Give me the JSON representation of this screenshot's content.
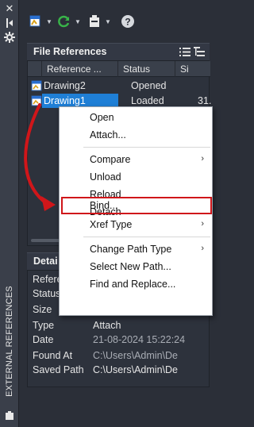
{
  "strip": {
    "vertical_label": "EXTERNAL REFERENCES",
    "icons": [
      "close-icon",
      "autohide-icon",
      "properties-icon"
    ]
  },
  "toolbar": {
    "buttons": [
      "attach-dwg-icon",
      "refresh-icon",
      "change-path-icon",
      "help-icon"
    ]
  },
  "file_references": {
    "title": "File References",
    "columns": [
      "Reference ...",
      "Status",
      "Si"
    ],
    "rows": [
      {
        "name": "Drawing2",
        "status": "Opened",
        "size": ""
      },
      {
        "name": "Drawing1",
        "status": "Loaded",
        "size": "31."
      }
    ],
    "selected_row": 1
  },
  "details": {
    "title": "Detai",
    "rows": [
      {
        "key": "Refere",
        "value": ""
      },
      {
        "key": "Status",
        "value": ""
      },
      {
        "key": "Size",
        "value": ""
      },
      {
        "key": "Type",
        "value": "Attach"
      },
      {
        "key": "Date",
        "value": "21-08-2024 15:22:24"
      },
      {
        "key": "Found At",
        "value": "C:\\Users\\Admin\\De"
      },
      {
        "key": "Saved Path",
        "value": "C:\\Users\\Admin\\De"
      }
    ]
  },
  "context_menu": {
    "items": [
      {
        "label": "Open",
        "submenu": false
      },
      {
        "label": "Attach...",
        "submenu": false
      },
      {
        "label": "Compare",
        "submenu": true
      },
      {
        "label": "Unload",
        "submenu": false
      },
      {
        "label": "Reload",
        "submenu": false
      },
      {
        "label": "Detach",
        "submenu": false
      },
      {
        "label": "Bind...",
        "submenu": false
      },
      {
        "label": "Xref Type",
        "submenu": true
      },
      {
        "label": "Change Path Type",
        "submenu": true
      },
      {
        "label": "Select New Path...",
        "submenu": false
      },
      {
        "label": "Find and Replace...",
        "submenu": false
      }
    ],
    "highlighted_item": "Bind...",
    "highlight_color": "#d0161a"
  },
  "colors": {
    "selection": "#1f7fd6",
    "panel_bg": "#2b2f38",
    "annotation_red": "#d0161a"
  }
}
